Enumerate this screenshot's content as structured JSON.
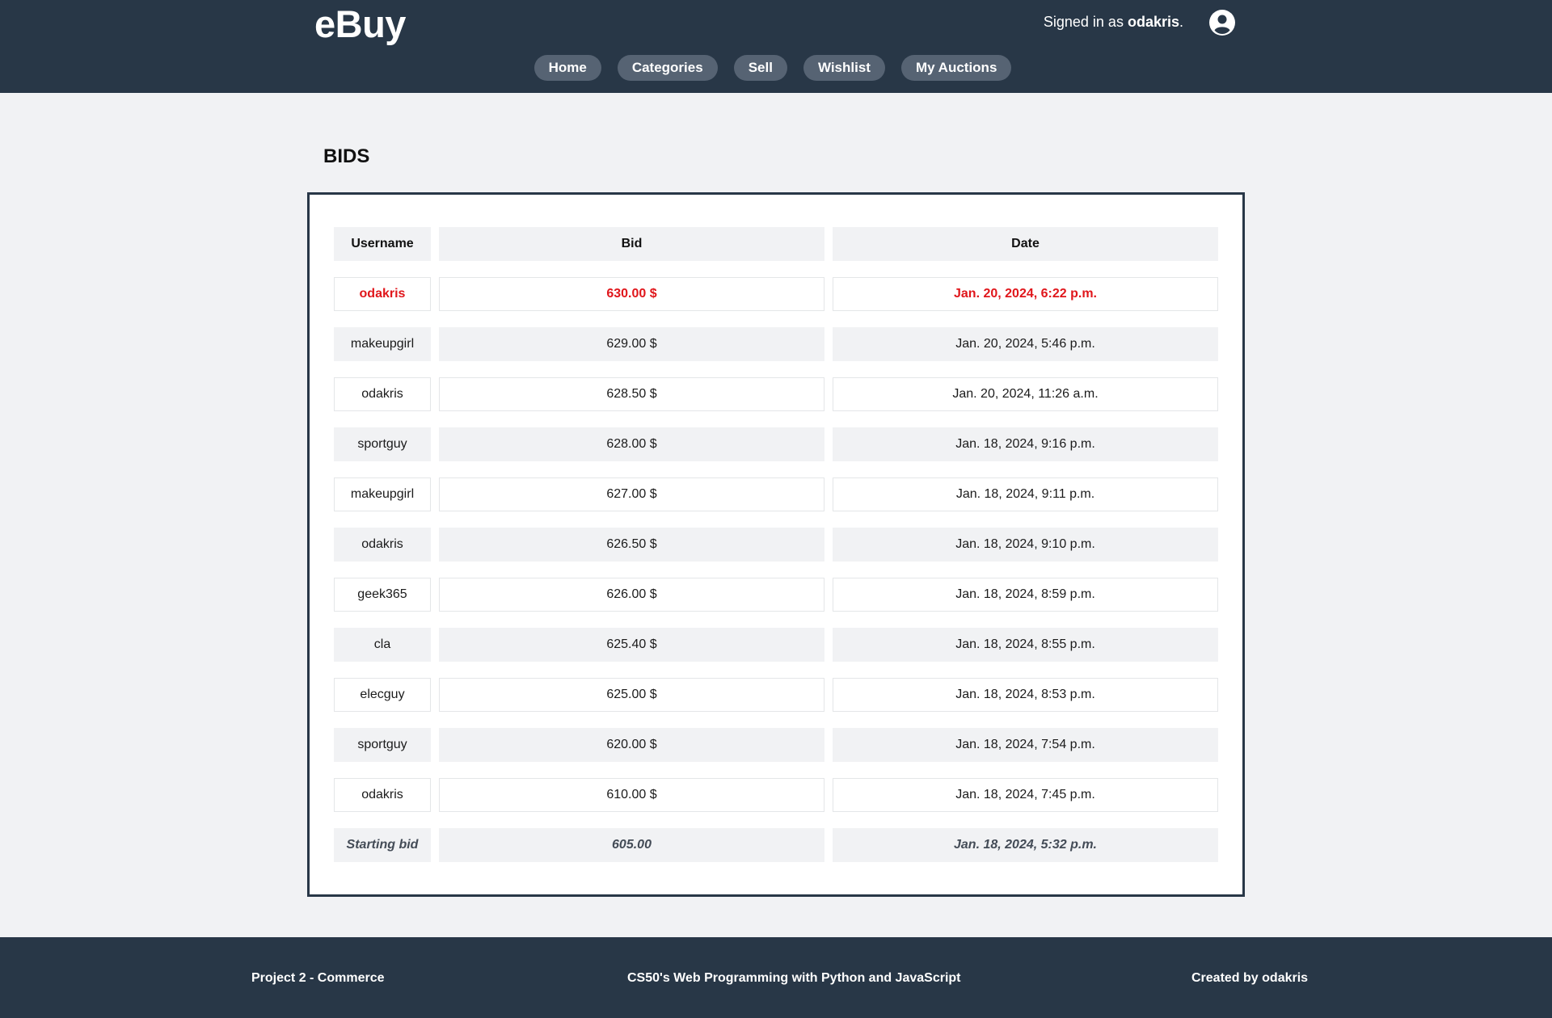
{
  "header": {
    "brand": "eBuy",
    "signed_prefix": "Signed in as ",
    "username": "odakris",
    "signed_suffix": ".",
    "user_icon": "account-circle-icon",
    "nav": [
      "Home",
      "Categories",
      "Sell",
      "Wishlist",
      "My Auctions"
    ]
  },
  "page": {
    "title": "BIDS"
  },
  "table": {
    "headers": [
      "Username",
      "Bid",
      "Date"
    ],
    "rows": [
      {
        "username": "odakris",
        "bid": "630.00 $",
        "date": "Jan. 20, 2024, 6:22 p.m."
      },
      {
        "username": "makeupgirl",
        "bid": "629.00 $",
        "date": "Jan. 20, 2024, 5:46 p.m."
      },
      {
        "username": "odakris",
        "bid": "628.50 $",
        "date": "Jan. 20, 2024, 11:26 a.m."
      },
      {
        "username": "sportguy",
        "bid": "628.00 $",
        "date": "Jan. 18, 2024, 9:16 p.m."
      },
      {
        "username": "makeupgirl",
        "bid": "627.00 $",
        "date": "Jan. 18, 2024, 9:11 p.m."
      },
      {
        "username": "odakris",
        "bid": "626.50 $",
        "date": "Jan. 18, 2024, 9:10 p.m."
      },
      {
        "username": "geek365",
        "bid": "626.00 $",
        "date": "Jan. 18, 2024, 8:59 p.m."
      },
      {
        "username": "cla",
        "bid": "625.40 $",
        "date": "Jan. 18, 2024, 8:55 p.m."
      },
      {
        "username": "elecguy",
        "bid": "625.00 $",
        "date": "Jan. 18, 2024, 8:53 p.m."
      },
      {
        "username": "sportguy",
        "bid": "620.00 $",
        "date": "Jan. 18, 2024, 7:54 p.m."
      },
      {
        "username": "odakris",
        "bid": "610.00 $",
        "date": "Jan. 18, 2024, 7:45 p.m."
      }
    ],
    "starting": {
      "username": "Starting bid",
      "bid": "605.00",
      "date": "Jan. 18, 2024, 5:32 p.m."
    }
  },
  "footer": {
    "left": "Project 2 - Commerce",
    "center": "CS50's Web Programming with Python and JavaScript",
    "right": "Created by odakris"
  },
  "colors": {
    "header_bg": "#283747",
    "nav_pill": "#566373",
    "highlight_red": "#e0161b",
    "row_gray": "#f1f2f4"
  }
}
